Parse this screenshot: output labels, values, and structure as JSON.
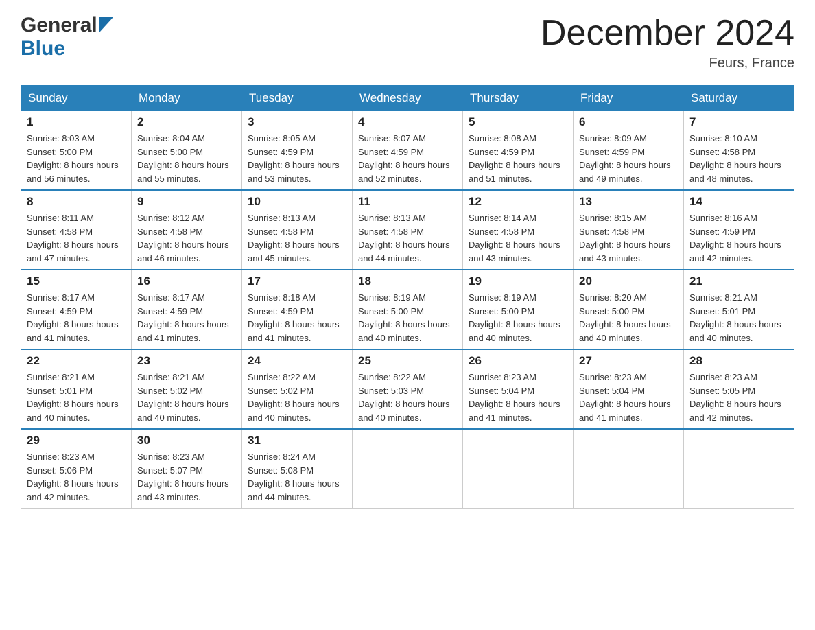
{
  "logo": {
    "text1": "General",
    "text2": "Blue"
  },
  "title": "December 2024",
  "location": "Feurs, France",
  "headers": [
    "Sunday",
    "Monday",
    "Tuesday",
    "Wednesday",
    "Thursday",
    "Friday",
    "Saturday"
  ],
  "weeks": [
    [
      {
        "day": "1",
        "sunrise": "8:03 AM",
        "sunset": "5:00 PM",
        "daylight": "8 hours and 56 minutes."
      },
      {
        "day": "2",
        "sunrise": "8:04 AM",
        "sunset": "5:00 PM",
        "daylight": "8 hours and 55 minutes."
      },
      {
        "day": "3",
        "sunrise": "8:05 AM",
        "sunset": "4:59 PM",
        "daylight": "8 hours and 53 minutes."
      },
      {
        "day": "4",
        "sunrise": "8:07 AM",
        "sunset": "4:59 PM",
        "daylight": "8 hours and 52 minutes."
      },
      {
        "day": "5",
        "sunrise": "8:08 AM",
        "sunset": "4:59 PM",
        "daylight": "8 hours and 51 minutes."
      },
      {
        "day": "6",
        "sunrise": "8:09 AM",
        "sunset": "4:59 PM",
        "daylight": "8 hours and 49 minutes."
      },
      {
        "day": "7",
        "sunrise": "8:10 AM",
        "sunset": "4:58 PM",
        "daylight": "8 hours and 48 minutes."
      }
    ],
    [
      {
        "day": "8",
        "sunrise": "8:11 AM",
        "sunset": "4:58 PM",
        "daylight": "8 hours and 47 minutes."
      },
      {
        "day": "9",
        "sunrise": "8:12 AM",
        "sunset": "4:58 PM",
        "daylight": "8 hours and 46 minutes."
      },
      {
        "day": "10",
        "sunrise": "8:13 AM",
        "sunset": "4:58 PM",
        "daylight": "8 hours and 45 minutes."
      },
      {
        "day": "11",
        "sunrise": "8:13 AM",
        "sunset": "4:58 PM",
        "daylight": "8 hours and 44 minutes."
      },
      {
        "day": "12",
        "sunrise": "8:14 AM",
        "sunset": "4:58 PM",
        "daylight": "8 hours and 43 minutes."
      },
      {
        "day": "13",
        "sunrise": "8:15 AM",
        "sunset": "4:58 PM",
        "daylight": "8 hours and 43 minutes."
      },
      {
        "day": "14",
        "sunrise": "8:16 AM",
        "sunset": "4:59 PM",
        "daylight": "8 hours and 42 minutes."
      }
    ],
    [
      {
        "day": "15",
        "sunrise": "8:17 AM",
        "sunset": "4:59 PM",
        "daylight": "8 hours and 41 minutes."
      },
      {
        "day": "16",
        "sunrise": "8:17 AM",
        "sunset": "4:59 PM",
        "daylight": "8 hours and 41 minutes."
      },
      {
        "day": "17",
        "sunrise": "8:18 AM",
        "sunset": "4:59 PM",
        "daylight": "8 hours and 41 minutes."
      },
      {
        "day": "18",
        "sunrise": "8:19 AM",
        "sunset": "5:00 PM",
        "daylight": "8 hours and 40 minutes."
      },
      {
        "day": "19",
        "sunrise": "8:19 AM",
        "sunset": "5:00 PM",
        "daylight": "8 hours and 40 minutes."
      },
      {
        "day": "20",
        "sunrise": "8:20 AM",
        "sunset": "5:00 PM",
        "daylight": "8 hours and 40 minutes."
      },
      {
        "day": "21",
        "sunrise": "8:21 AM",
        "sunset": "5:01 PM",
        "daylight": "8 hours and 40 minutes."
      }
    ],
    [
      {
        "day": "22",
        "sunrise": "8:21 AM",
        "sunset": "5:01 PM",
        "daylight": "8 hours and 40 minutes."
      },
      {
        "day": "23",
        "sunrise": "8:21 AM",
        "sunset": "5:02 PM",
        "daylight": "8 hours and 40 minutes."
      },
      {
        "day": "24",
        "sunrise": "8:22 AM",
        "sunset": "5:02 PM",
        "daylight": "8 hours and 40 minutes."
      },
      {
        "day": "25",
        "sunrise": "8:22 AM",
        "sunset": "5:03 PM",
        "daylight": "8 hours and 40 minutes."
      },
      {
        "day": "26",
        "sunrise": "8:23 AM",
        "sunset": "5:04 PM",
        "daylight": "8 hours and 41 minutes."
      },
      {
        "day": "27",
        "sunrise": "8:23 AM",
        "sunset": "5:04 PM",
        "daylight": "8 hours and 41 minutes."
      },
      {
        "day": "28",
        "sunrise": "8:23 AM",
        "sunset": "5:05 PM",
        "daylight": "8 hours and 42 minutes."
      }
    ],
    [
      {
        "day": "29",
        "sunrise": "8:23 AM",
        "sunset": "5:06 PM",
        "daylight": "8 hours and 42 minutes."
      },
      {
        "day": "30",
        "sunrise": "8:23 AM",
        "sunset": "5:07 PM",
        "daylight": "8 hours and 43 minutes."
      },
      {
        "day": "31",
        "sunrise": "8:24 AM",
        "sunset": "5:08 PM",
        "daylight": "8 hours and 44 minutes."
      },
      null,
      null,
      null,
      null
    ]
  ],
  "labels": {
    "sunrise": "Sunrise:",
    "sunset": "Sunset:",
    "daylight": "Daylight:"
  }
}
